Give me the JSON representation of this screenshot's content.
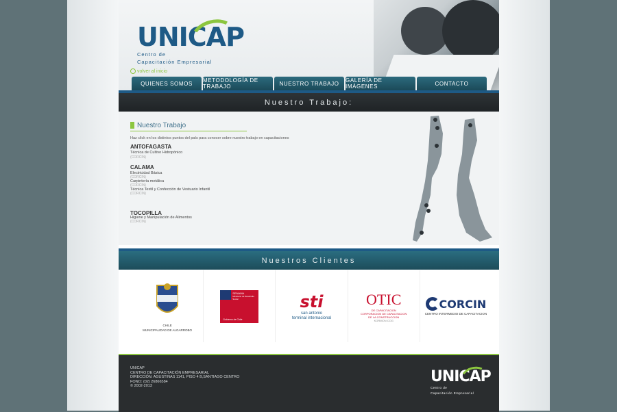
{
  "header": {
    "logo": {
      "main": "UNICAP",
      "sub_line1": "Centro de",
      "sub_line2": "Capacitación Empresarial"
    },
    "back_link": "volver al inicio"
  },
  "nav": [
    "QUIENES SOMOS",
    "METODOLOGÍA DE TRABAJO",
    "NUESTRO TRABAJO",
    "GALERÍA DE IMÁGENES",
    "CONTACTO"
  ],
  "section_bar": "Nuestro Trabajo:",
  "work": {
    "title": "Nuestro Trabajo",
    "intro": "Haz click en los distintos puntos del país para conocer sobre nuestro trabajo en capacitaciones",
    "cities": [
      {
        "name": "ANTOFAGASTA",
        "items": [
          {
            "course": "Técnica de Cultivo Hidropónico",
            "source": "(CORCIN)"
          }
        ]
      },
      {
        "name": "CALAMA",
        "items": [
          {
            "course": "Electricidad Básica",
            "source": "(CORCIN)"
          },
          {
            "course": "Carpintería metálica",
            "source": "(CORCIN)"
          },
          {
            "course": "Técnica Textil y Confección de Vestuario Infantil",
            "source": "(CORCIN)"
          }
        ]
      },
      {
        "name": "TOCOPILLA",
        "items": [
          {
            "course": "Higiene y Manipulación de Alimentos",
            "source": "(CORCIN)"
          }
        ]
      }
    ]
  },
  "clients_bar": "Nuestros Clientes",
  "clients": {
    "algarrobo": {
      "caption": "MUNICIPALIDAD DE ALGARROBO",
      "badge": "CHILE"
    },
    "sence": {
      "label": "SENAMA",
      "sub": "Ministerio de Desarrollo Social",
      "footer": "Gobierno de Chile"
    },
    "sti": {
      "name": "sti",
      "sub1": "san antonio",
      "sub2": "terminal internacional"
    },
    "otic": {
      "name": "OTIC",
      "sub1": "DE CAPACITACION",
      "sub2": "CORPORACION DE CAPACITACION",
      "sub3": "DE LA CONSTRUCCION",
      "sub4": "KORMON COG"
    },
    "corcin": {
      "name": "CORCIN",
      "sub": "CENTRO INTERMEDIO DE CAPACITACION"
    }
  },
  "footer": {
    "lines": [
      "UNICAP",
      "CENTRO DE CAPACITACIÓN EMPRESARIAL",
      "DIRECCIÓN: AGUSTINAS 1141, PISO 4 B,SANTIAGO CENTRO",
      "FONO: (02) 26866584",
      "© 2002-2013"
    ],
    "logo": {
      "main": "UNICAP",
      "sub_line1": "Centro de",
      "sub_line2": "Capacitación Empresarial"
    }
  },
  "colors": {
    "brand_blue": "#1e5a86",
    "brand_green": "#8cc63f",
    "nav_teal": "#2c6a7d",
    "footer_bg": "#2a2d2f"
  }
}
